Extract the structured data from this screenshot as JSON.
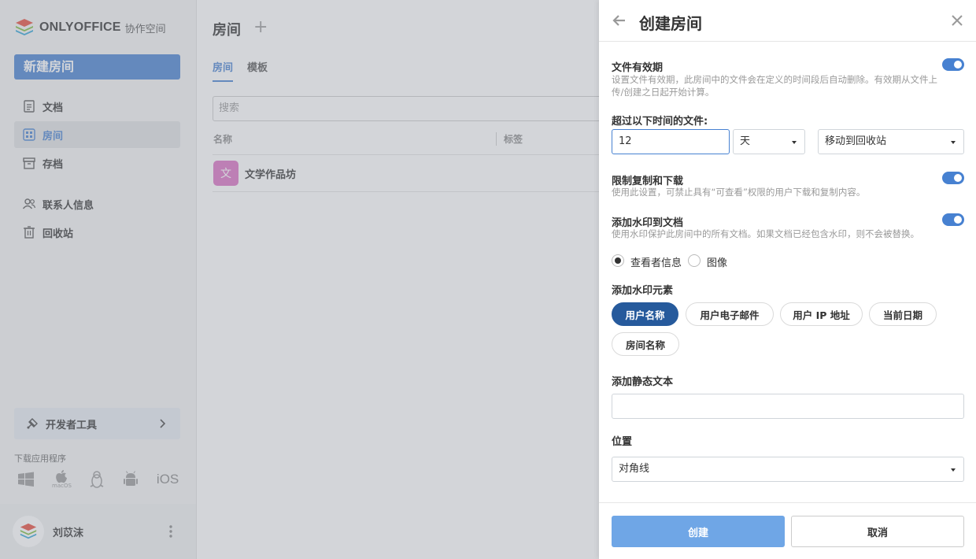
{
  "brand": {
    "name": "ONLYOFFICE",
    "suffix": "协作空间"
  },
  "sidebar": {
    "new_room_label": "新建房间",
    "items": [
      {
        "label": "文档",
        "icon": "document-icon"
      },
      {
        "label": "房间",
        "icon": "rooms-icon",
        "active": true
      },
      {
        "label": "存档",
        "icon": "archive-icon"
      },
      {
        "label": "联系人信息",
        "icon": "contacts-icon"
      },
      {
        "label": "回收站",
        "icon": "trash-icon"
      }
    ],
    "dev_tools_label": "开发者工具",
    "download_label": "下载应用程序",
    "download_apps": [
      "windows-icon",
      "macos-icon",
      "linux-icon",
      "android-icon",
      "iOS"
    ],
    "macos_caption": "macOS",
    "user_name": "刘苡沫"
  },
  "main": {
    "title": "房间",
    "tabs": [
      "房间",
      "模板"
    ],
    "search_placeholder": "搜索",
    "columns": [
      "名称",
      "标签"
    ],
    "rooms": [
      {
        "initial": "文",
        "name": "文学作品坊",
        "color": "#da70c4"
      }
    ]
  },
  "panel": {
    "title": "创建房间",
    "file_lifetime": {
      "label": "文件有效期",
      "desc": "设置文件有效期，此房间中的文件会在定义的时间段后自动删除。有效期从文件上传/创建之日起开始计算。",
      "enabled": true,
      "older_than_label": "超过以下时间的文件:",
      "value": "12",
      "unit": "天",
      "action": "移动到回收站"
    },
    "restrict": {
      "label": "限制复制和下载",
      "desc": "使用此设置，可禁止具有“可查看”权限的用户下载和复制内容。",
      "enabled": true
    },
    "watermark": {
      "label": "添加水印到文档",
      "desc": "使用水印保护此房间中的所有文档。如果文档已经包含水印，则不会被替换。",
      "enabled": true,
      "type_options": [
        "查看者信息",
        "图像"
      ],
      "selected_type": "查看者信息",
      "elements_label": "添加水印元素",
      "elements": [
        {
          "label": "用户名称",
          "selected": true
        },
        {
          "label": "用户电子邮件",
          "selected": false
        },
        {
          "label": "用户 IP 地址",
          "selected": false
        },
        {
          "label": "当前日期",
          "selected": false
        },
        {
          "label": "房间名称",
          "selected": false
        }
      ],
      "static_text_label": "添加静态文本",
      "static_text_value": "",
      "position_label": "位置",
      "position_value": "对角线"
    },
    "create_label": "创建",
    "cancel_label": "取消"
  },
  "colors": {
    "accent": "#4781d1",
    "chip_selected": "#265a9c",
    "primary_button": "#6fa6e6"
  }
}
